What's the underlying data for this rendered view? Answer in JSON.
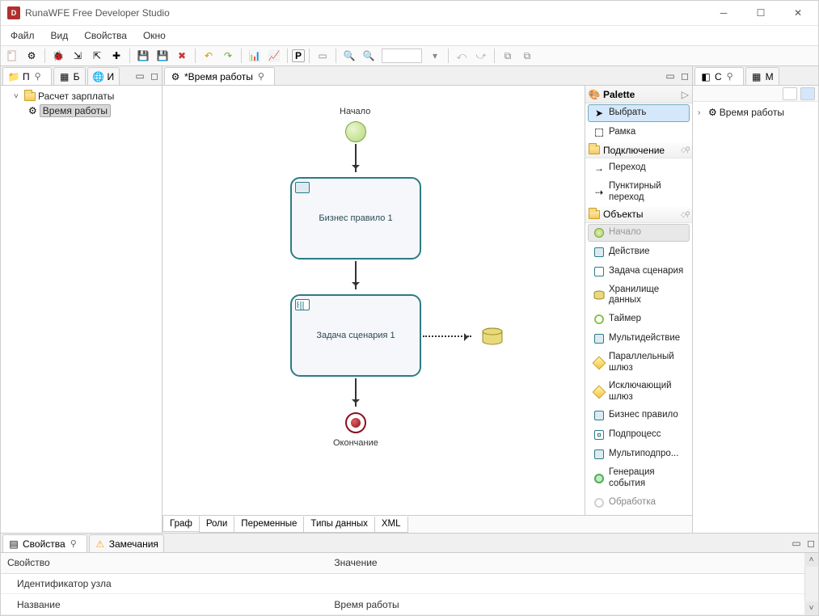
{
  "title": "RunaWFE Free Developer Studio",
  "menu": [
    "Файл",
    "Вид",
    "Свойства",
    "Окно"
  ],
  "tree": {
    "root": "Расчет зарплаты",
    "child": "Время работы"
  },
  "left_tabs": [
    "П",
    "Б",
    "И"
  ],
  "editor_tab": "*Время работы",
  "canvas": {
    "start_label": "Начало",
    "node1": "Бизнес правило 1",
    "node2": "Задача сценария 1",
    "end_label": "Окончание"
  },
  "palette": {
    "title": "Palette",
    "select": "Выбрать",
    "marquee": "Рамка",
    "grp_conn": "Подключение",
    "conn1": "Переход",
    "conn2": "Пунктирный переход",
    "grp_obj": "Объекты",
    "obj_start": "Начало",
    "obj_action": "Действие",
    "obj_script": "Задача сценария",
    "obj_data": "Хранилище данных",
    "obj_timer": "Таймер",
    "obj_multi": "Мультидействие",
    "obj_par": "Параллельный шлюз",
    "obj_excl": "Исключающий шлюз",
    "obj_rule": "Бизнес правило",
    "obj_sub": "Подпроцесс",
    "obj_multisub": "Мультиподпро...",
    "obj_event": "Генерация события",
    "obj_proc": "Обработка"
  },
  "bottom_tabs": [
    "Граф",
    "Роли",
    "Переменные",
    "Типы данных",
    "XML"
  ],
  "right_tabs": [
    "С",
    "М"
  ],
  "outline_item": "Время работы",
  "props": {
    "tab1": "Свойства",
    "tab2": "Замечания",
    "col1": "Свойство",
    "col2": "Значение",
    "row1_k": "Идентификатор узла",
    "row1_v": "",
    "row2_k": "Название",
    "row2_v": "Время работы"
  }
}
